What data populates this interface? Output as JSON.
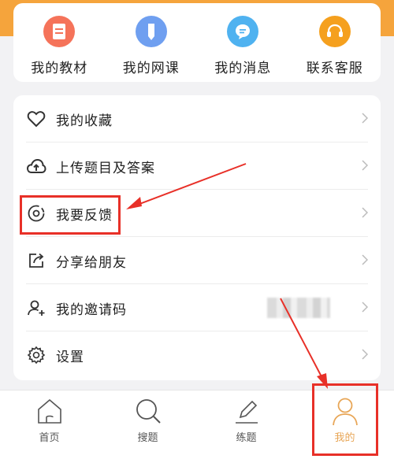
{
  "shortcuts": [
    {
      "label": "我的教材",
      "color": "#f5735a"
    },
    {
      "label": "我的网课",
      "color": "#6f9ff0"
    },
    {
      "label": "我的消息",
      "color": "#4fb2f0"
    },
    {
      "label": "联系客服",
      "color": "#f5a01e"
    }
  ],
  "menu": {
    "favorites": "我的收藏",
    "upload": "上传题目及答案",
    "feedback": "我要反馈",
    "share": "分享给朋友",
    "invite": "我的邀请码",
    "settings": "设置"
  },
  "tabs": {
    "home": "首页",
    "search": "搜题",
    "practice": "练题",
    "me": "我的"
  },
  "annotation_color": "#e83028"
}
